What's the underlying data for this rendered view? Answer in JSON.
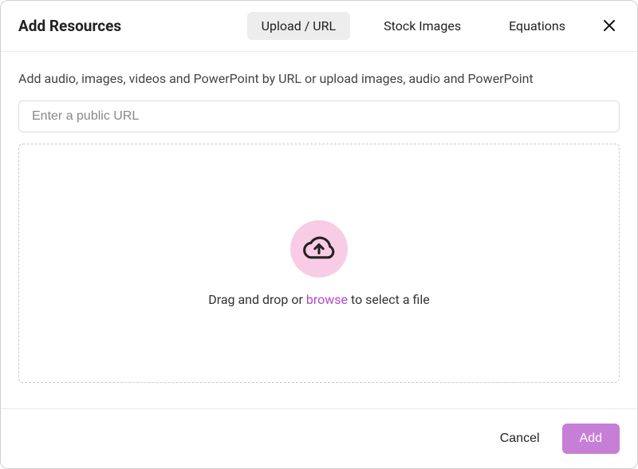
{
  "header": {
    "title": "Add Resources"
  },
  "tabs": {
    "upload_url": "Upload / URL",
    "stock_images": "Stock Images",
    "equations": "Equations"
  },
  "body": {
    "description": "Add audio, images, videos and PowerPoint by URL or upload images, audio and PowerPoint",
    "url_placeholder": "Enter a public URL",
    "dropzone_prefix": "Drag and drop or ",
    "dropzone_browse": "browse",
    "dropzone_suffix": " to select a file"
  },
  "footer": {
    "cancel": "Cancel",
    "add": "Add"
  }
}
